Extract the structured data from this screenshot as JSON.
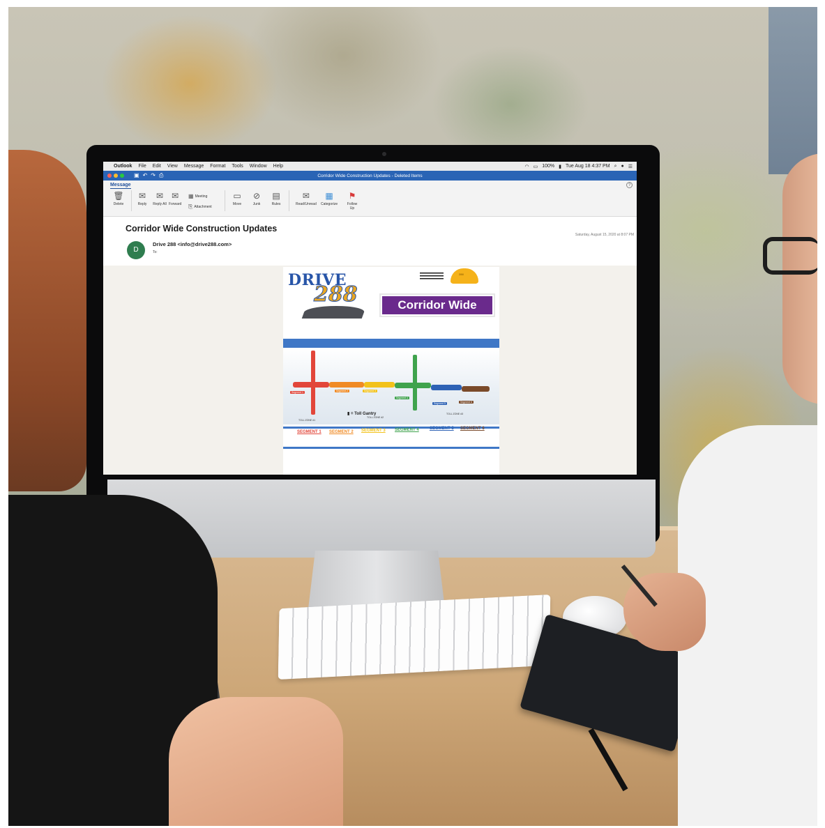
{
  "menubar": {
    "app": "Outlook",
    "items": [
      "File",
      "Edit",
      "View",
      "Message",
      "Format",
      "Tools",
      "Window",
      "Help"
    ],
    "battery": "100%",
    "clock": "Tue Aug 18  4:37 PM"
  },
  "window": {
    "title": "Corridor Wide Construction Updates - Deleted Items",
    "traffic_lights": [
      "#ff5f57",
      "#febc2e",
      "#28c840"
    ],
    "accent": "#2a64b5"
  },
  "ribbon": {
    "tab": "Message",
    "delete": "Delete",
    "reply": "Reply",
    "reply_all": "Reply All",
    "forward": "Forward",
    "meeting": "Meeting",
    "attachment": "Attachment",
    "move": "Move",
    "junk": "Junk",
    "rules": "Rules",
    "read_unread": "Read/Unread",
    "categorize": "Categorize",
    "follow_up": "Follow Up",
    "help": "?"
  },
  "message": {
    "subject": "Corridor Wide Construction Updates",
    "date": "Saturday, August 15, 2020 at 8:07 PM",
    "avatar_initial": "D",
    "avatar_color": "#2f7d4f",
    "sender": "Drive 288 <info@drive288.com>",
    "to_label": "To:"
  },
  "newsletter": {
    "logo_word": "DRIVE",
    "logo_number": "288",
    "badge": "Corridor Wide",
    "badge_color": "#6a2a8c",
    "hardhat_text": "288",
    "map": {
      "gantry_legend": "= Toll Gantry",
      "zones": [
        "TOLL ZONE #1",
        "TOLL ZONE #2",
        "TOLL ZONE #3"
      ],
      "segment_tags": [
        "Segment 1",
        "Segment 2",
        "Segment 3",
        "Segment 4",
        "Segment 5",
        "Segment 6"
      ]
    },
    "segment_links": [
      {
        "label": "SEGMENT 1",
        "color": "#e2463a"
      },
      {
        "label": "SEGMENT 2",
        "color": "#f08a24"
      },
      {
        "label": "SEGMENT 3",
        "color": "#f2c21b"
      },
      {
        "label": "SEGMENT 4",
        "color": "#3fa34d"
      },
      {
        "label": "SEGMENT 5",
        "color": "#2e62b5"
      },
      {
        "label": "SEGMENT 6",
        "color": "#7a4a2a"
      }
    ]
  }
}
